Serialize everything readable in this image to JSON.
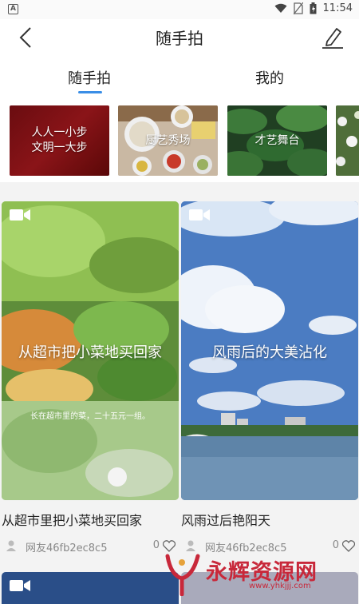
{
  "status_bar": {
    "time": "11:54"
  },
  "header": {
    "title": "随手拍"
  },
  "tabs": [
    {
      "label": "随手拍",
      "active": true
    },
    {
      "label": "我的",
      "active": false
    }
  ],
  "categories": [
    {
      "label": "人人一小步\n文明一大步"
    },
    {
      "label": "厨艺秀场"
    },
    {
      "label": "才艺舞台"
    },
    {
      "label": ""
    }
  ],
  "posts": [
    {
      "title": "从超市里把小菜地买回家",
      "thumb_caption": "从超市把小菜地买回家",
      "thumb_subcaption": "长在超市里的菜，二十五元一组。",
      "user": "网友46fb2ec8c5",
      "likes": "0"
    },
    {
      "title": "风雨过后艳阳天",
      "thumb_caption": "风雨后的大美沾化",
      "thumb_subcaption": "",
      "user": "网友46fb2ec8c5",
      "likes": "0"
    }
  ],
  "watermark": {
    "text": "永辉资源网",
    "url": "www.yhkjjj.com"
  },
  "colors": {
    "accent": "#3a8ee6",
    "watermark": "#c8283a"
  }
}
